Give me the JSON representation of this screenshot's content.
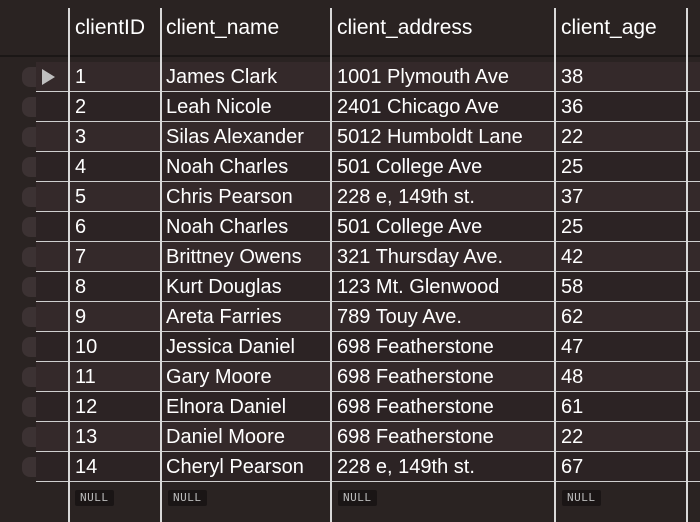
{
  "table": {
    "columns": [
      "clientID",
      "client_name",
      "client_address",
      "client_age"
    ],
    "rows": [
      [
        "1",
        "James Clark",
        "1001 Plymouth Ave",
        "38"
      ],
      [
        "2",
        "Leah Nicole",
        "2401 Chicago Ave",
        "36"
      ],
      [
        "3",
        "Silas Alexander",
        "5012 Humboldt Lane",
        "22"
      ],
      [
        "4",
        "Noah Charles",
        "501 College Ave",
        "25"
      ],
      [
        "5",
        "Chris Pearson",
        "228 e, 149th st.",
        "37"
      ],
      [
        "6",
        "Noah Charles",
        "501 College Ave",
        "25"
      ],
      [
        "7",
        "Brittney Owens",
        "321 Thursday Ave.",
        "42"
      ],
      [
        "8",
        "Kurt Douglas",
        "123 Mt. Glenwood",
        "58"
      ],
      [
        "9",
        "Areta Farries",
        "789 Touy Ave.",
        "62"
      ],
      [
        "10",
        "Jessica Daniel",
        "698 Featherstone",
        "47"
      ],
      [
        "11",
        "Gary Moore",
        "698 Featherstone",
        "48"
      ],
      [
        "12",
        "Elnora Daniel",
        "698 Featherstone",
        "61"
      ],
      [
        "13",
        "Daniel Moore",
        "698 Featherstone",
        "22"
      ],
      [
        "14",
        "Cheryl Pearson",
        "228 e, 149th st.",
        "67"
      ]
    ],
    "null_label": "NULL",
    "selected_row_marker": "play-triangle-icon"
  }
}
